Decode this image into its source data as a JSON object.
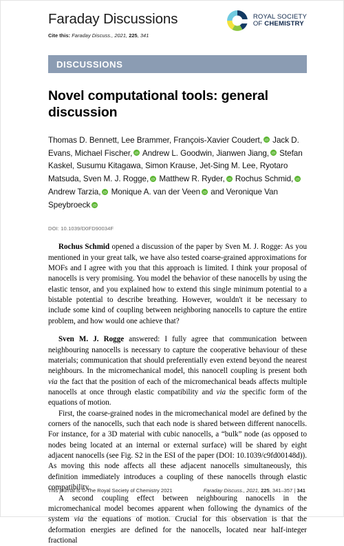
{
  "masthead": {
    "journal_title": "Faraday Discussions",
    "cite_label": "Cite this:",
    "cite_reference": "Faraday Discuss., 2021, 225, 341",
    "cite_journal": "Faraday Discuss.",
    "cite_year": ", 2021, ",
    "cite_volume": "225",
    "cite_page": ", 341",
    "publisher_line_1": "ROYAL SOCIETY",
    "publisher_of": "OF ",
    "publisher_chemistry": "CHEMISTRY",
    "logo_name": "royal-society-of-chemistry-logo"
  },
  "banner": {
    "label": "DISCUSSIONS",
    "color": "#8b9cb3"
  },
  "article": {
    "title": "Novel computational tools: general discussion",
    "doi": "DOI: 10.1039/D0FD90034F",
    "authors_text": "Thomas D. Bennett, Lee Brammer, François-Xavier Coudert, Jack D. Evans, Michael Fischer, Andrew L. Goodwin, Jianwen Jiang, Stefan Kaskel, Susumu Kitagawa, Simon Krause, Jet-Sing M. Lee, Ryotaro Matsuda, Sven M. J. Rogge, Matthew R. Ryder, Rochus Schmid, Andrew Tarzia, Monique A. van der Veen and Veronique Van Speybroeck",
    "author_segments": [
      {
        "text": "Thomas D. Bennett, Lee Brammer, François-Xavier Coudert,",
        "orcid": true
      },
      {
        "text": " Jack D. Evans, Michael Fischer,",
        "orcid": true
      },
      {
        "text": " Andrew L. Goodwin, Jianwen Jiang,",
        "orcid": true
      },
      {
        "text": " Stefan Kaskel, Susumu Kitagawa, Simon Krause, Jet-Sing M. Lee, Ryotaro Matsuda, Sven M. J. Rogge,",
        "orcid": true
      },
      {
        "text": " Matthew R. Ryder,",
        "orcid": true
      },
      {
        "text": " Rochus Schmid,",
        "orcid": true
      },
      {
        "text": " Andrew Tarzia,",
        "orcid": true
      },
      {
        "text": " Monique A. van der Veen",
        "orcid": true
      },
      {
        "text": " and Veronique Van Speybroeck",
        "orcid": true
      }
    ],
    "orcid_color": "#5bb531"
  },
  "body": {
    "paragraphs": [
      {
        "indent": true,
        "runs": [
          {
            "style": "bold",
            "text": "Rochus Schmid"
          },
          {
            "style": "normal",
            "text": " opened a discussion of the paper by Sven M. J. Rogge: As you mentioned in your great talk, we have also tested coarse-grained approximations for MOFs and I agree with you that this approach is limited. I think your proposal of nanocells is very promising. You model the behavior of these nanocells by using the elastic tensor, and you explained how to extend this single minimum potential to a bistable potential to describe breathing. However, wouldn't it be necessary to include some kind of coupling between neighboring nanocells to capture the entire problem, and how would one achieve that?"
          }
        ]
      },
      {
        "indent": true,
        "spacer_before": true,
        "runs": [
          {
            "style": "bold",
            "text": "Sven M. J. Rogge"
          },
          {
            "style": "normal",
            "text": " answered: I fully agree that communication between neighbouring nanocells is necessary to capture the cooperative behaviour of these materials; communication that should preferentially even extend beyond the nearest neighbours. In the micromechanical model, this nanocell coupling is present both "
          },
          {
            "style": "italic",
            "text": "via"
          },
          {
            "style": "normal",
            "text": " the fact that the position of each of the micromechanical beads affects multiple nanocells at once through elastic compatibility and "
          },
          {
            "style": "italic",
            "text": "via"
          },
          {
            "style": "normal",
            "text": " the specific form of the equations of motion."
          }
        ]
      },
      {
        "indent": true,
        "runs": [
          {
            "style": "normal",
            "text": "First, the coarse-grained nodes in the micromechanical model are defined by the corners of the nanocells, such that each node is shared between different nanocells. For instance, for a 3D material with cubic nanocells, a “bulk” node (as opposed to nodes being located at an internal or external surface) will be shared by eight adjacent nanocells (see Fig. S2 in the ESI of the paper (DOI: 10.1039/c9fd00148d)). As moving this node affects all these adjacent nanocells simultaneously, this definition immediately introduces a coupling of these nanocells through elastic compatibility."
          }
        ]
      },
      {
        "indent": true,
        "runs": [
          {
            "style": "normal",
            "text": "A second coupling effect between neighbouring nanocells in the micromechanical model becomes apparent when following the dynamics of the system "
          },
          {
            "style": "italic",
            "text": "via"
          },
          {
            "style": "normal",
            "text": " the equations of motion. Crucial for this observation is that the deformation energies are defined for the nanocells, located near half-integer fractional"
          }
        ]
      }
    ]
  },
  "footer": {
    "left": "This journal is © The Royal Society of Chemistry 2021",
    "journal": "Faraday Discuss.",
    "year": ", 2021, ",
    "volume": "225",
    "pages": ", 341–357 | ",
    "page_number": "341"
  }
}
